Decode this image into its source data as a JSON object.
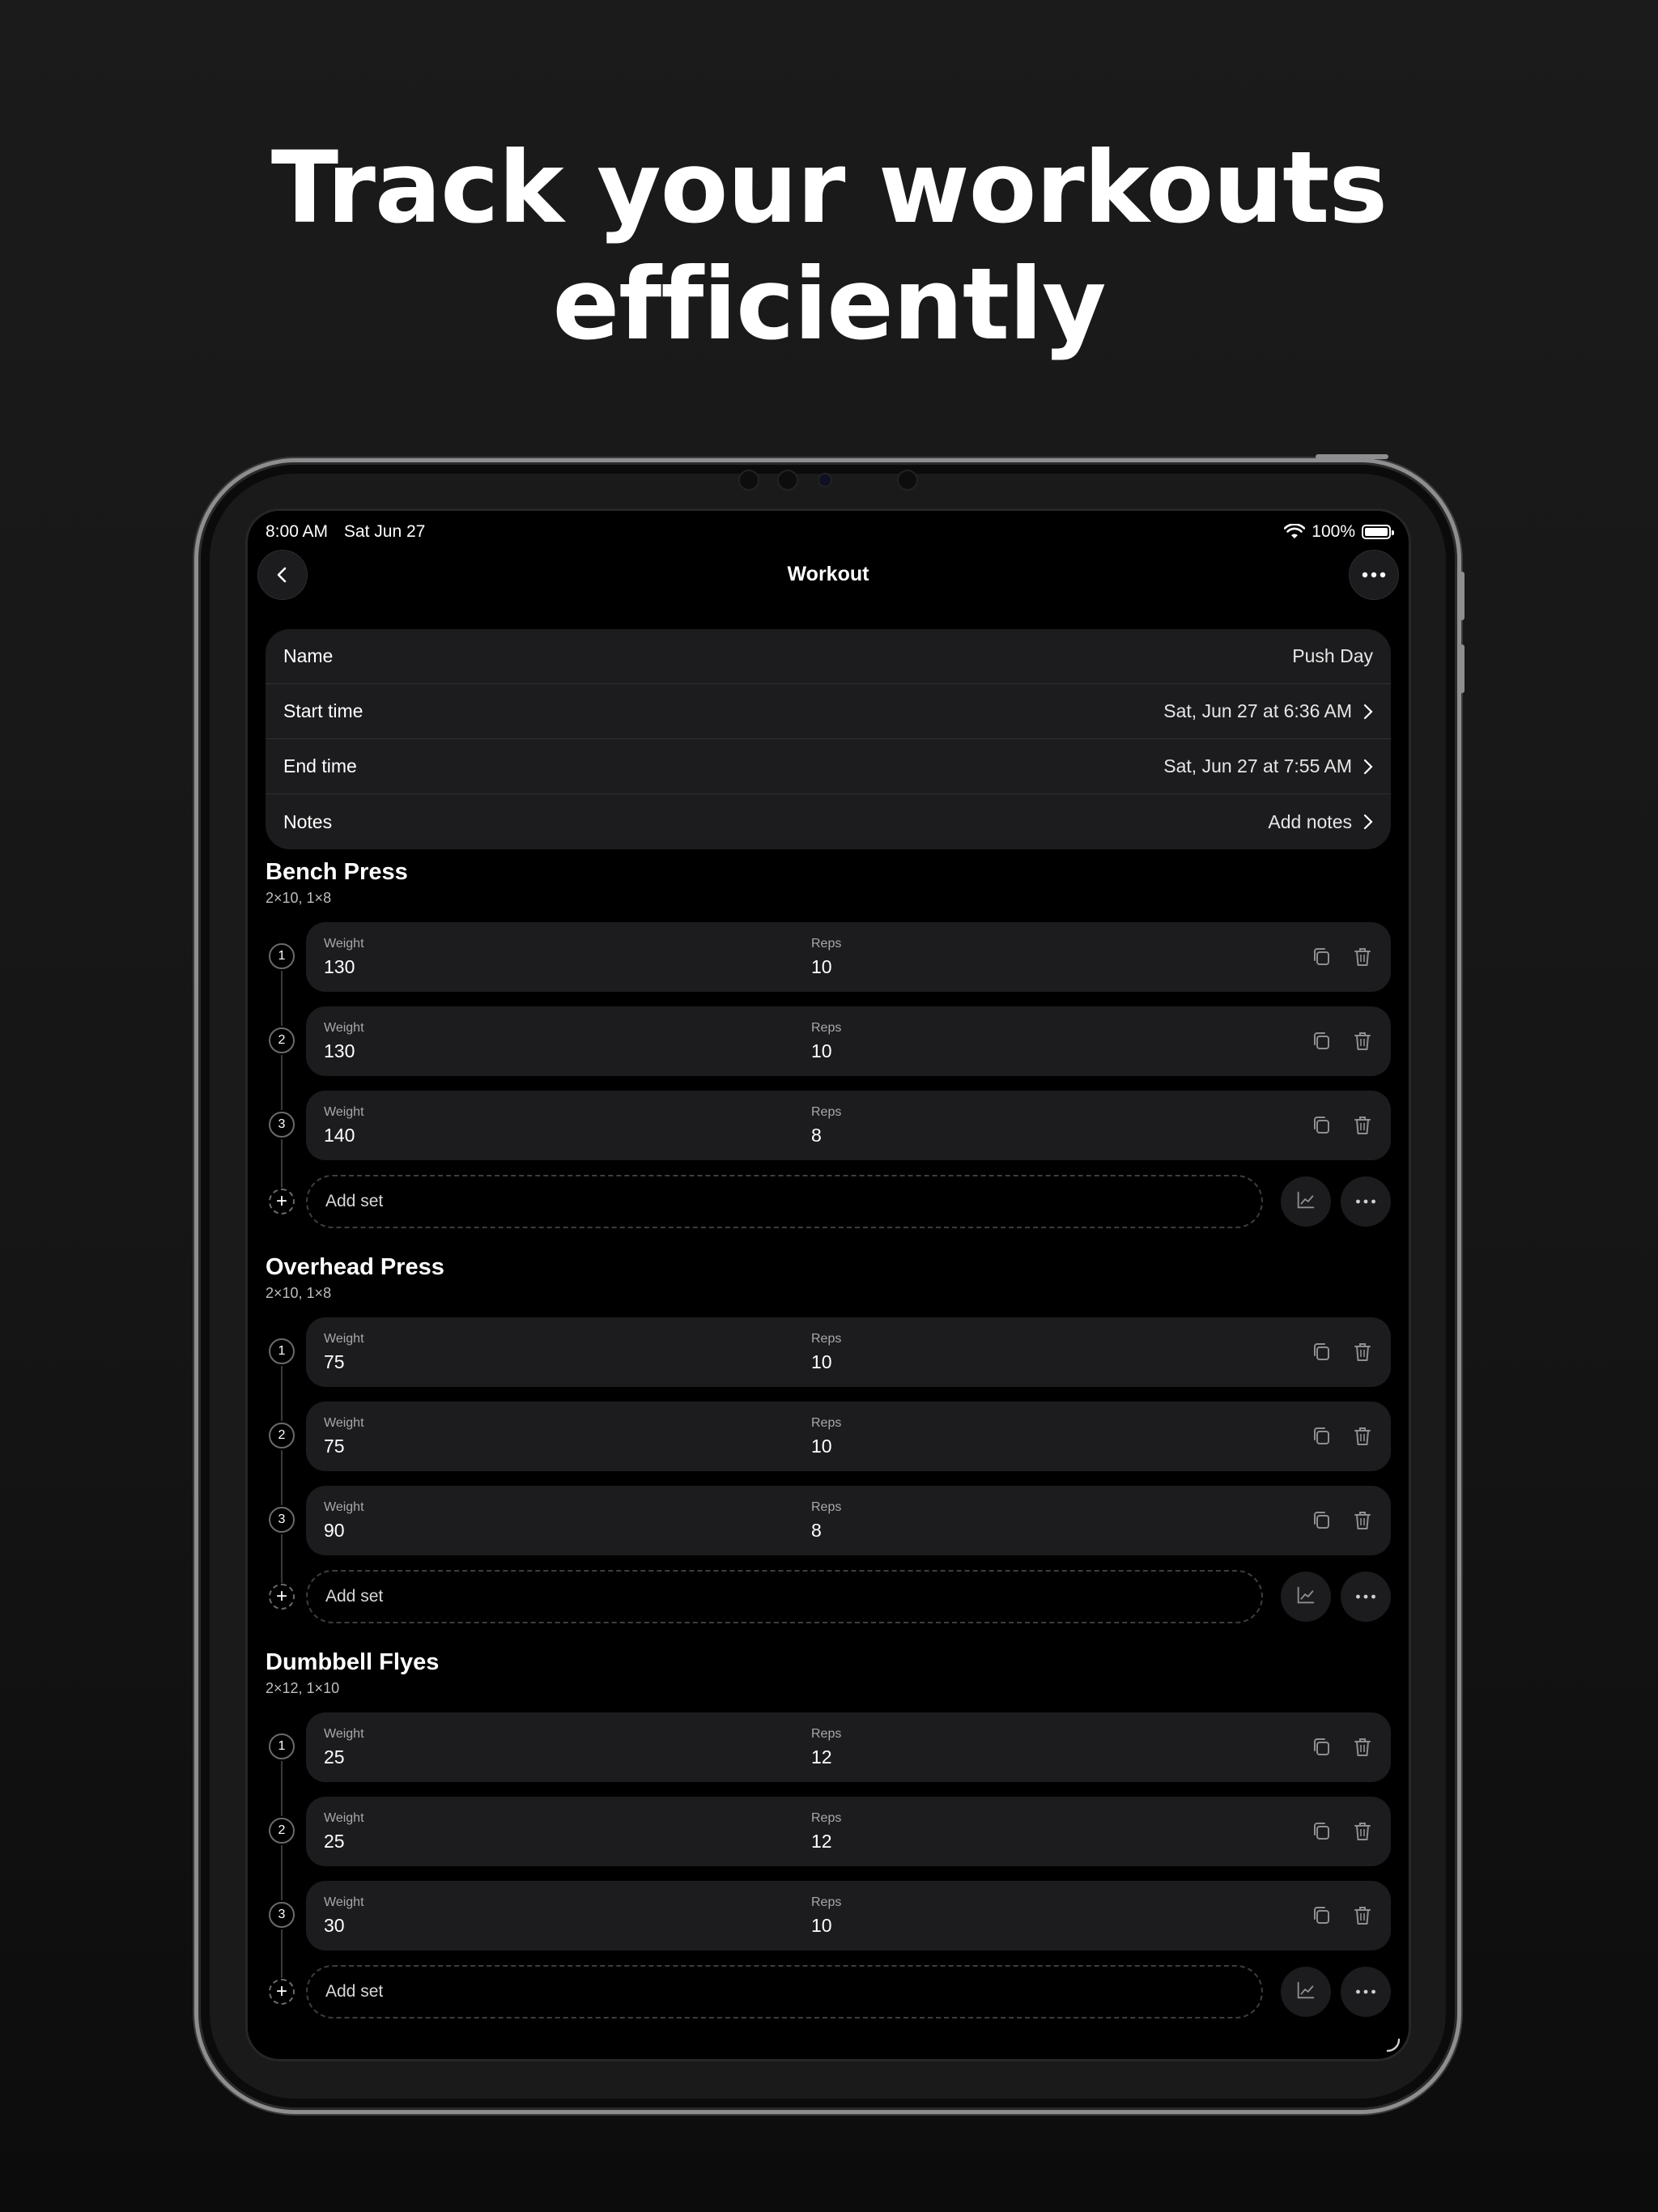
{
  "headline": {
    "line1": "Track your workouts",
    "line2": "efficiently"
  },
  "status_bar": {
    "time": "8:00 AM",
    "date": "Sat Jun 27",
    "battery": "100%"
  },
  "nav": {
    "title": "Workout",
    "back_icon": "chevron-left-icon",
    "more_icon": "ellipsis-icon"
  },
  "info": {
    "rows": [
      {
        "label": "Name",
        "value": "Push Day"
      },
      {
        "label": "Start time",
        "value": "Sat, Jun 27 at 6:36 AM"
      },
      {
        "label": "End time",
        "value": "Sat, Jun 27 at 7:55 AM"
      },
      {
        "label": "Notes",
        "value": "Add notes"
      }
    ]
  },
  "labels": {
    "weight": "Weight",
    "reps": "Reps",
    "add_set": "Add set"
  },
  "exercises": [
    {
      "name": "Bench Press",
      "summary": "2×10, 1×8",
      "sets": [
        {
          "num": "1",
          "weight": "130",
          "reps": "10"
        },
        {
          "num": "2",
          "weight": "130",
          "reps": "10"
        },
        {
          "num": "3",
          "weight": "140",
          "reps": "8"
        }
      ]
    },
    {
      "name": "Overhead Press",
      "summary": "2×10, 1×8",
      "sets": [
        {
          "num": "1",
          "weight": "75",
          "reps": "10"
        },
        {
          "num": "2",
          "weight": "75",
          "reps": "10"
        },
        {
          "num": "3",
          "weight": "90",
          "reps": "8"
        }
      ]
    },
    {
      "name": "Dumbbell Flyes",
      "summary": "2×12, 1×10",
      "sets": [
        {
          "num": "1",
          "weight": "25",
          "reps": "12"
        },
        {
          "num": "2",
          "weight": "25",
          "reps": "12"
        },
        {
          "num": "3",
          "weight": "30",
          "reps": "10"
        }
      ]
    }
  ]
}
